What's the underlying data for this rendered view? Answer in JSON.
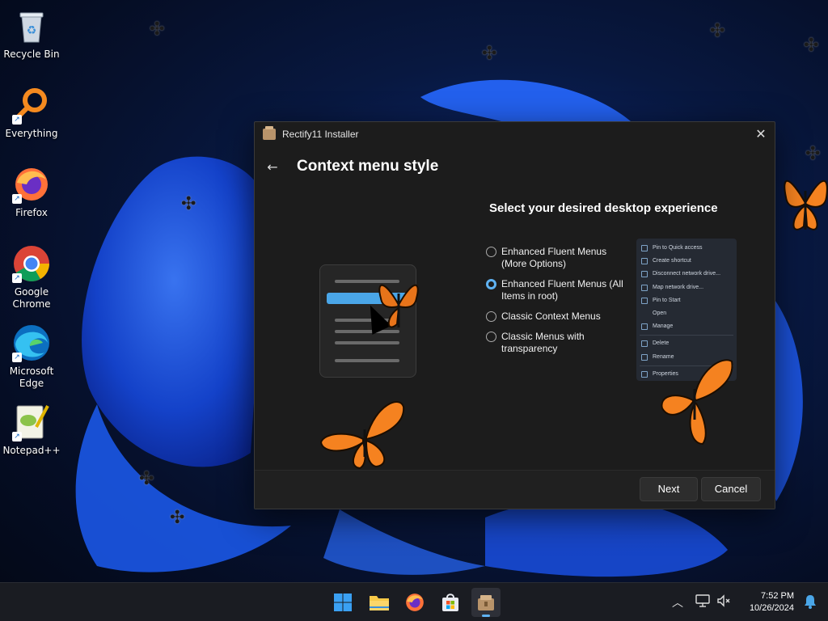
{
  "desktop": {
    "icons": [
      {
        "label": "Recycle Bin",
        "icon": "recycle-bin-icon"
      },
      {
        "label": "Everything",
        "icon": "everything-search-icon"
      },
      {
        "label": "Firefox",
        "icon": "firefox-icon"
      },
      {
        "label": "Google Chrome",
        "icon": "chrome-icon"
      },
      {
        "label": "Microsoft Edge",
        "icon": "edge-icon"
      },
      {
        "label": "Notepad++",
        "icon": "notepadpp-icon"
      }
    ]
  },
  "window": {
    "title": "Rectify11 Installer",
    "page_title": "Context menu style",
    "subtitle": "Select your desired desktop experience",
    "options": [
      {
        "label": "Enhanced Fluent Menus (More Options)",
        "selected": false
      },
      {
        "label": "Enhanced Fluent Menus (All Items in root)",
        "selected": true
      },
      {
        "label": "Classic Context Menus",
        "selected": false
      },
      {
        "label": "Classic Menus with transparency",
        "selected": false
      }
    ],
    "preview_menu": [
      "Pin to Quick access",
      "Create shortcut",
      "Disconnect network drive...",
      "Map network drive...",
      "Pin to Start",
      "Open",
      "Manage",
      "Delete",
      "Rename",
      "Properties"
    ],
    "buttons": {
      "next": "Next",
      "cancel": "Cancel"
    }
  },
  "taskbar": {
    "apps": [
      "start-icon",
      "file-explorer-icon",
      "firefox-icon",
      "microsoft-store-icon",
      "rectify11-installer-icon"
    ],
    "time": "7:52 PM",
    "date": "10/26/2024"
  }
}
